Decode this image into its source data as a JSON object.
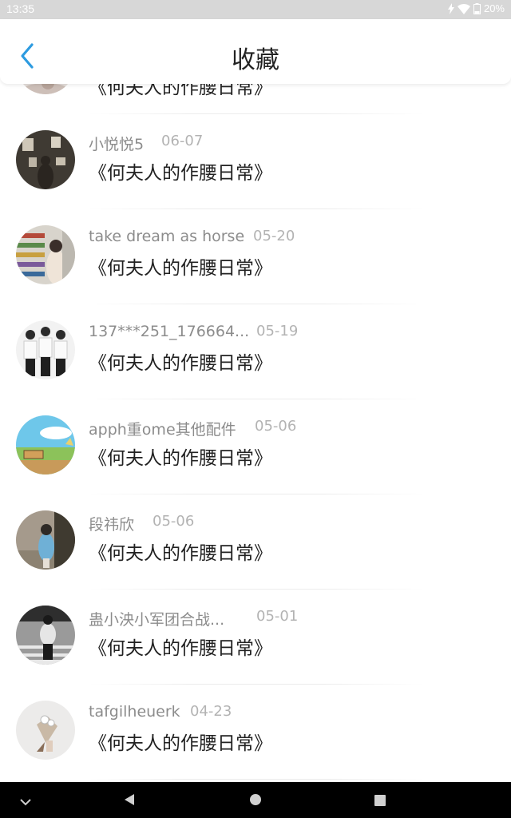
{
  "status_bar": {
    "time": "13:35",
    "battery": "20%"
  },
  "header": {
    "title": "收藏",
    "back_icon": "chevron-left-icon"
  },
  "items": [
    {
      "user": "",
      "date": "",
      "title": "《何夫人的作腰日常》"
    },
    {
      "user": "小悦悦5",
      "date": "06-07",
      "title": "《何夫人的作腰日常》"
    },
    {
      "user": "take dream as horse",
      "date": "05-20",
      "title": "《何夫人的作腰日常》"
    },
    {
      "user": "137***251_176664...",
      "date": "05-19",
      "title": "《何夫人的作腰日常》"
    },
    {
      "user": "apph重ome其他配件",
      "date": "05-06",
      "title": "《何夫人的作腰日常》"
    },
    {
      "user": "段祎欣",
      "date": "05-06",
      "title": "《何夫人的作腰日常》"
    },
    {
      "user": "蛊小泱小军团合战...",
      "date": "05-01",
      "title": "《何夫人的作腰日常》"
    },
    {
      "user": "tafgilheuerk",
      "date": "04-23",
      "title": "《何夫人的作腰日常》"
    }
  ],
  "colors": {
    "accent": "#2d9be0",
    "title_text": "#222222",
    "user_text": "#8c8c8c",
    "date_text": "#b3b3b3",
    "status_bar": "#d7d7d7",
    "nav_bar": "#000000"
  },
  "nav_bar": {
    "buttons": [
      "chevron-down-icon",
      "back-triangle-icon",
      "home-circle-icon",
      "recents-square-icon"
    ]
  }
}
